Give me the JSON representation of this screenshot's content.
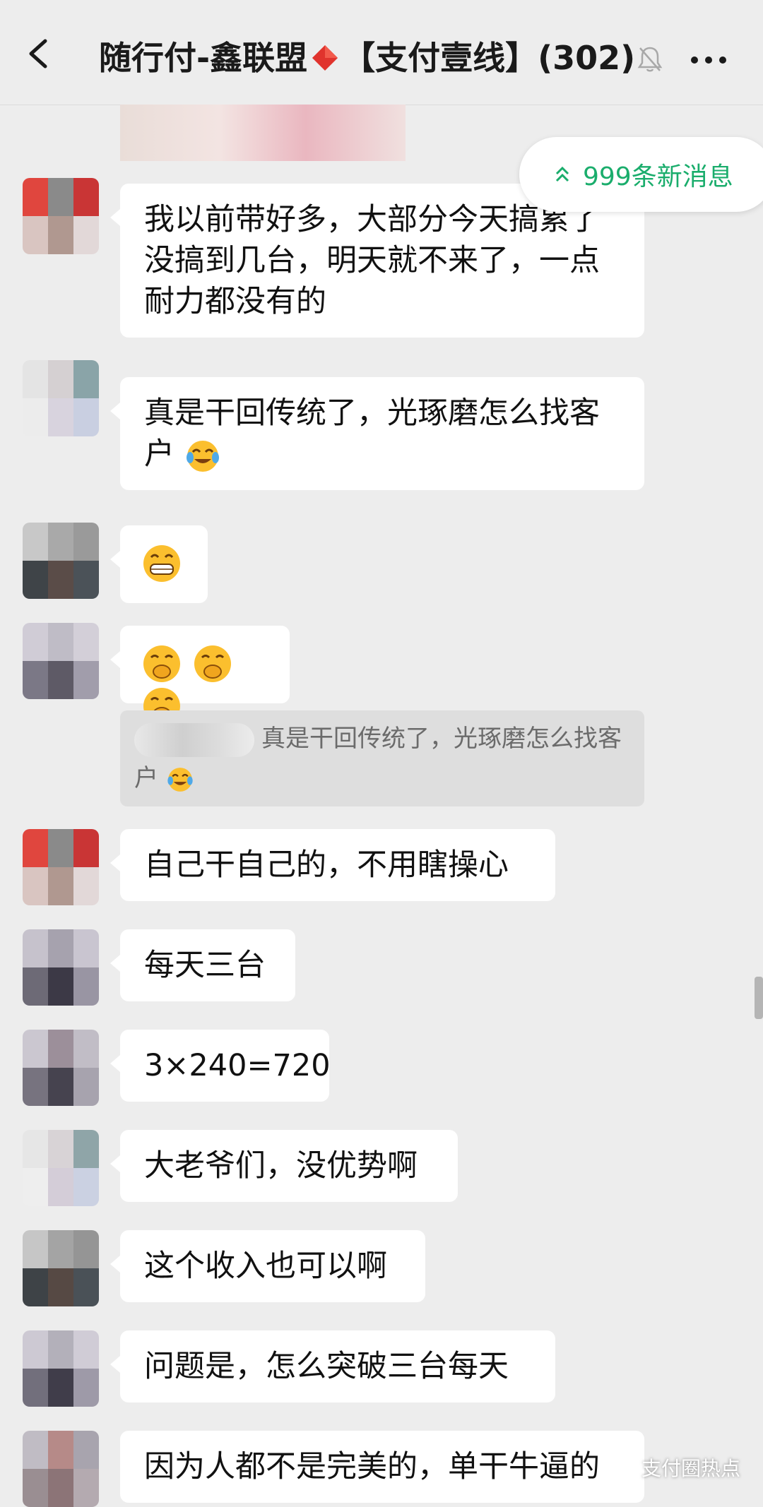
{
  "header": {
    "title_prefix": "随行付-鑫联盟",
    "title_suffix": "【支付壹线】(302)",
    "back_icon": "chevron-left-icon",
    "mute_icon": "bell-off-icon",
    "more_icon": "ellipsis-icon"
  },
  "new_messages": {
    "label": "999条新消息",
    "icon": "double-chevron-up-icon",
    "color": "#1aad6c"
  },
  "messages": [
    {
      "text": "我以前带好多，大部分今天搞累了没搞到几台，明天就不来了，一点耐力都没有的"
    },
    {
      "text": "真是干回传统了，光琢磨怎么找客户",
      "emoji": "face-with-tears-of-joy"
    },
    {
      "emoji": "grinning-face"
    },
    {
      "emoji": "face-with-hand-over-mouth"
    },
    {
      "quote": "真是干回传统了，光琢磨怎么找客户",
      "quote_emoji": "face-with-tears-of-joy"
    },
    {
      "text": "自己干自己的，不用瞎操心"
    },
    {
      "text": "每天三台"
    },
    {
      "text": "3×240=720"
    },
    {
      "text": "大老爷们，没优势啊"
    },
    {
      "text": "这个收入也可以啊"
    },
    {
      "text": "问题是，怎么突破三台每天"
    },
    {
      "text": "因为人都不是完美的，单干牛逼的"
    }
  ],
  "watermark": {
    "label": "支付圈热点",
    "icon": "wechat-channel-icon"
  }
}
